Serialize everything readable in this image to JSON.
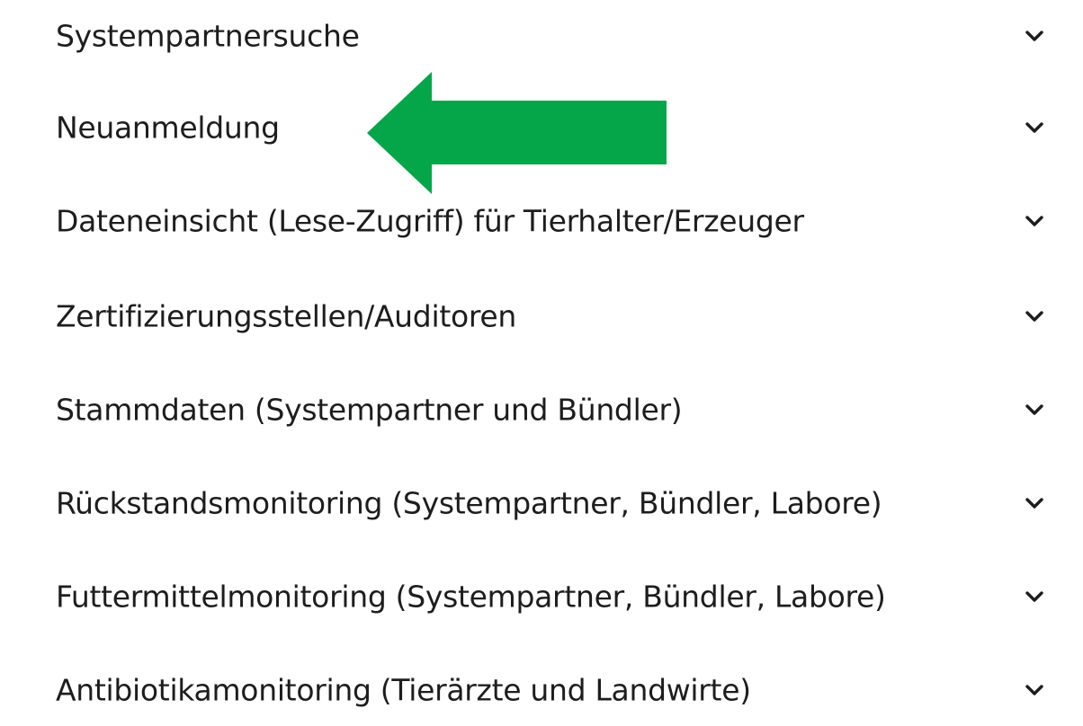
{
  "menu": {
    "items": [
      {
        "label": "Systempartnersuche"
      },
      {
        "label": "Neuanmeldung"
      },
      {
        "label": "Dateneinsicht (Lese-Zugriff) für Tierhalter/Erzeuger"
      },
      {
        "label": "Zertifizierungsstellen/Auditoren"
      },
      {
        "label": "Stammdaten (Systempartner und Bündler)"
      },
      {
        "label": "Rückstandsmonitoring (Systempartner, Bündler, Labore)"
      },
      {
        "label": "Futtermittelmonitoring (Systempartner, Bündler, Labore)"
      },
      {
        "label": "Antibiotikamonitoring (Tierärzte und Landwirte)"
      }
    ],
    "chevron_icon": "chevron-down-icon"
  },
  "annotation": {
    "icon": "arrow-left-icon",
    "color": "#05a64a",
    "points_to": "Neuanmeldung"
  },
  "colors": {
    "text": "#1d1d1d",
    "background": "#ffffff"
  }
}
